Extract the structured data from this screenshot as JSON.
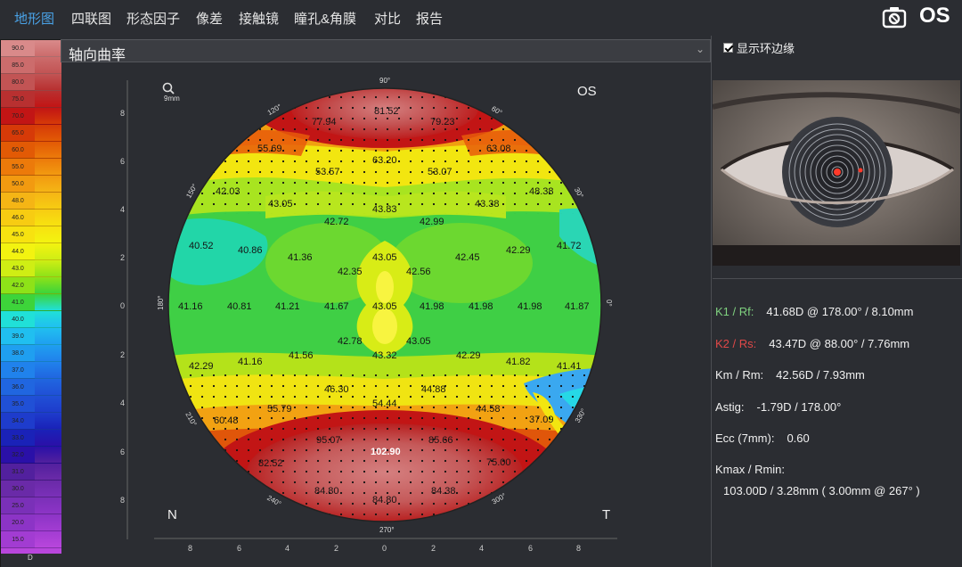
{
  "tabs": [
    {
      "label": "地形图",
      "active": true
    },
    {
      "label": "四联图",
      "active": false
    },
    {
      "label": "形态因子",
      "active": false
    },
    {
      "label": "像差",
      "active": false
    },
    {
      "label": "接触镜",
      "active": false
    },
    {
      "label": "瞳孔&角膜",
      "active": false
    },
    {
      "label": "对比",
      "active": false
    },
    {
      "label": "报告",
      "active": false
    }
  ],
  "eye_label": "OS",
  "camera_icon": "camera-icon",
  "scale": {
    "unit": "D",
    "steps": [
      {
        "label": "90.0",
        "color": "#d98a8a"
      },
      {
        "label": "85.0",
        "color": "#cc6c6c"
      },
      {
        "label": "80.0",
        "color": "#c25454"
      },
      {
        "label": "75.0",
        "color": "#b83030"
      },
      {
        "label": "70.0",
        "color": "#c21515"
      },
      {
        "label": "65.0",
        "color": "#d63a08"
      },
      {
        "label": "60.0",
        "color": "#e25a05"
      },
      {
        "label": "55.0",
        "color": "#ec7a0a"
      },
      {
        "label": "50.0",
        "color": "#f29a10"
      },
      {
        "label": "48.0",
        "color": "#f5b515"
      },
      {
        "label": "46.0",
        "color": "#f7cc12"
      },
      {
        "label": "45.0",
        "color": "#f7e210"
      },
      {
        "label": "44.0",
        "color": "#f3f310"
      },
      {
        "label": "43.0",
        "color": "#cfee14"
      },
      {
        "label": "42.0",
        "color": "#8ee218"
      },
      {
        "label": "41.0",
        "color": "#3dd43a"
      },
      {
        "label": "40.0",
        "color": "#20e0d8"
      },
      {
        "label": "39.0",
        "color": "#20bff0"
      },
      {
        "label": "38.0",
        "color": "#1f9ff0"
      },
      {
        "label": "37.0",
        "color": "#2082ec"
      },
      {
        "label": "36.0",
        "color": "#2066e0"
      },
      {
        "label": "35.0",
        "color": "#2050d6"
      },
      {
        "label": "34.0",
        "color": "#1e3ccc"
      },
      {
        "label": "33.0",
        "color": "#1a22b8"
      },
      {
        "label": "32.0",
        "color": "#2a10a8"
      },
      {
        "label": "31.0",
        "color": "#52209e"
      },
      {
        "label": "30.0",
        "color": "#6a2aa8"
      },
      {
        "label": "25.0",
        "color": "#7a30b8"
      },
      {
        "label": "20.0",
        "color": "#8c34c6"
      },
      {
        "label": "15.0",
        "color": "#a23cd2"
      },
      {
        "label": "10.0",
        "color": "#b846dc"
      }
    ]
  },
  "map_type": {
    "label": "轴向曲率"
  },
  "map": {
    "zoom_label": "9mm",
    "eye_label": "OS",
    "corner_left": "N",
    "corner_right": "T",
    "angle_labels": [
      "90°",
      "60°",
      "30°",
      "0°",
      "330°",
      "300°",
      "270°",
      "240°",
      "210°",
      "180°",
      "150°",
      "120°"
    ],
    "y_ticks": [
      "8",
      "6",
      "4",
      "2",
      "0",
      "2",
      "4",
      "6",
      "8"
    ],
    "x_ticks": [
      "8",
      "6",
      "4",
      "2",
      "0",
      "2",
      "4",
      "6",
      "8"
    ],
    "values": [
      "81.52",
      "77.94",
      "79.23",
      "55.69",
      "63.20",
      "63.08",
      "53.57",
      "53.07",
      "42.03",
      "43.05",
      "43.38",
      "48.38",
      "42.72",
      "43.83",
      "42.99",
      "40.52",
      "40.86",
      "41.36",
      "43.05",
      "42.45",
      "42.29",
      "41.72",
      "42.35",
      "42.56",
      "41.16",
      "40.81",
      "41.21",
      "41.67",
      "43.05",
      "41.98",
      "41.98",
      "41.98",
      "41.87",
      "42.78",
      "43.05",
      "41.56",
      "43.32",
      "42.29",
      "42.29",
      "41.16",
      "41.82",
      "41.41",
      "46.30",
      "44.88",
      "55.79",
      "54.44",
      "44.58",
      "37.09",
      "60.48",
      "95.07",
      "85.66",
      "82.52",
      "102.90",
      "75.00",
      "84.80",
      "84.38",
      "84.80"
    ]
  },
  "rim_checkbox": {
    "label": "显示环边缘",
    "checked": true
  },
  "metrics": {
    "k1_label": "K1 / Rf:",
    "k1_value": "41.68D @ 178.00° / 8.10mm",
    "k1_color": "#7fd17f",
    "k2_label": "K2 / Rs:",
    "k2_value": "43.47D @ 88.00° / 7.76mm",
    "k2_color": "#e04848",
    "km_label": "Km / Rm:",
    "km_value": "42.56D / 7.93mm",
    "astig_label": "Astig:",
    "astig_value": "-1.79D / 178.00°",
    "ecc_label": "Ecc (7mm):",
    "ecc_value": "0.60",
    "kmax_label": "Kmax / Rmin:",
    "kmax_value": "103.00D / 3.28mm ( 3.00mm @ 267° )"
  }
}
